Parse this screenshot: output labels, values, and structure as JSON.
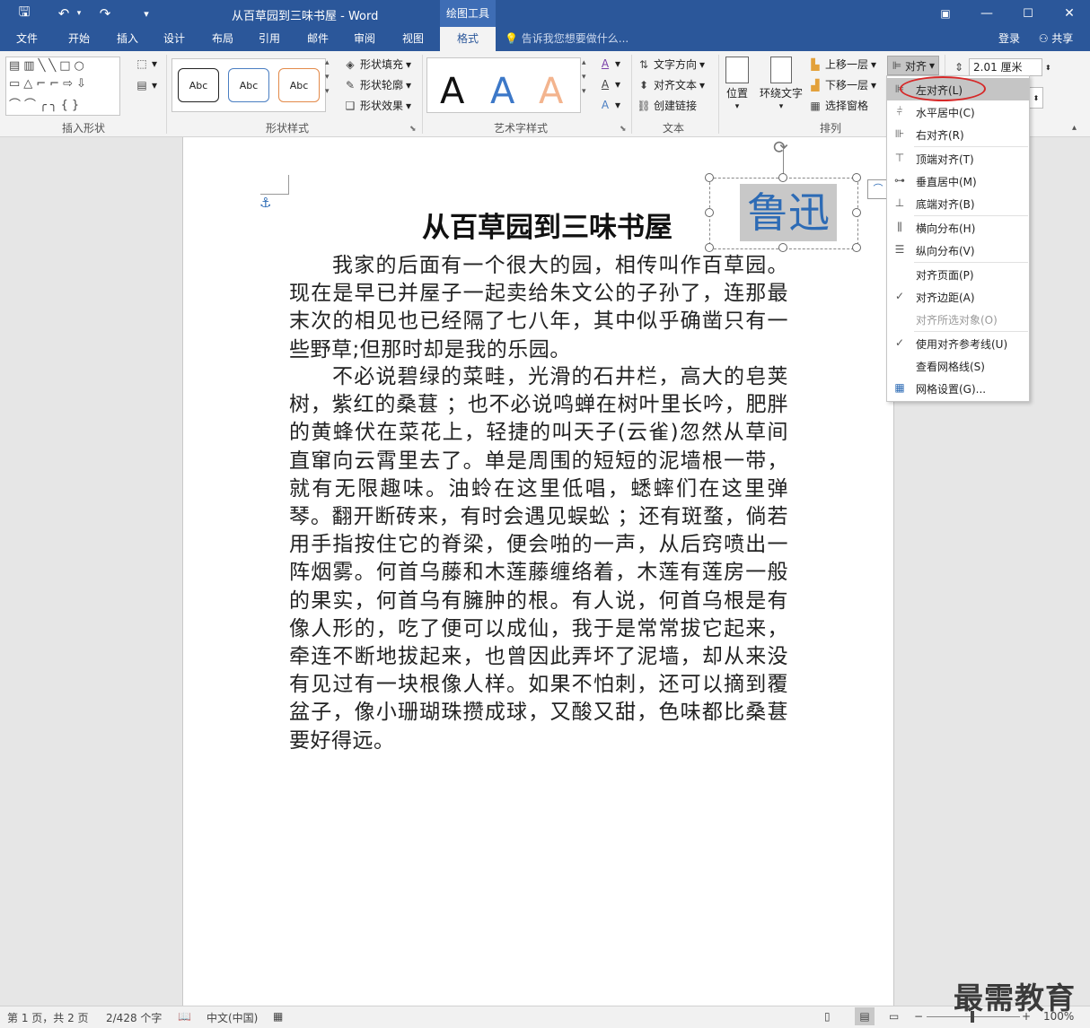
{
  "window": {
    "title": "从百草园到三味书屋 - Word",
    "context_label": "绘图工具"
  },
  "tabs": [
    "文件",
    "开始",
    "插入",
    "设计",
    "布局",
    "引用",
    "邮件",
    "审阅",
    "视图",
    "格式"
  ],
  "active_tab": "格式",
  "tell_me": "告诉我您想要做什么...",
  "login": "登录",
  "share": "共享",
  "ribbon": {
    "groups": {
      "insert_shapes": "插入形状",
      "shape_styles": "形状样式",
      "wordart_styles": "艺术字样式",
      "text": "文本",
      "arrange": "排列"
    },
    "shape_style_samples": [
      "Abc",
      "Abc",
      "Abc"
    ],
    "shape_fill": "形状填充",
    "shape_outline": "形状轮廓",
    "shape_effects": "形状效果",
    "wordart_letter": "A",
    "text_direction": "文字方向",
    "align_text": "对齐文本",
    "create_link": "创建链接",
    "position": "位置",
    "wrap_text": "环绕文字",
    "bring_forward": "上移一层",
    "send_backward": "下移一层",
    "selection_pane": "选择窗格",
    "align": "对齐",
    "height_value": "2.01 厘米"
  },
  "align_menu": [
    {
      "label": "左对齐(L)",
      "icon": "align-left-icon",
      "highlight": true
    },
    {
      "label": "水平居中(C)",
      "icon": "align-center-icon"
    },
    {
      "label": "右对齐(R)",
      "icon": "align-right-icon"
    },
    {
      "label": "顶端对齐(T)",
      "icon": "align-top-icon"
    },
    {
      "label": "垂直居中(M)",
      "icon": "align-middle-icon"
    },
    {
      "label": "底端对齐(B)",
      "icon": "align-bottom-icon"
    },
    {
      "label": "横向分布(H)",
      "icon": "distribute-horizontal-icon"
    },
    {
      "label": "纵向分布(V)",
      "icon": "distribute-vertical-icon"
    },
    {
      "label": "对齐页面(P)",
      "icon": ""
    },
    {
      "label": "对齐边距(A)",
      "icon": "check-icon"
    },
    {
      "label": "对齐所选对象(O)",
      "icon": "",
      "disabled": true
    },
    {
      "label": "使用对齐参考线(U)",
      "icon": "check-icon"
    },
    {
      "label": "查看网格线(S)",
      "icon": ""
    },
    {
      "label": "网格设置(G)...",
      "icon": "grid-icon"
    }
  ],
  "document": {
    "title": "从百草园到三味书屋",
    "textbox": "鲁迅",
    "paragraphs": [
      "我家的后面有一个很大的园，相传叫作百草园。现在是早已并屋子一起卖给朱文公的子孙了，连那最末次的相见也已经隔了七八年，其中似乎确凿只有一些野草;但那时却是我的乐园。",
      "不必说碧绿的菜畦，光滑的石井栏，高大的皂荚树，紫红的桑葚 ；也不必说鸣蝉在树叶里长吟，肥胖的黄蜂伏在菜花上，轻捷的叫天子(云雀)忽然从草间直窜向云霄里去了。单是周围的短短的泥墙根一带，就有无限趣味。油蛉在这里低唱，蟋蟀们在这里弹琴。翻开断砖来，有时会遇见蜈蚣 ；还有斑蝥，倘若用手指按住它的脊梁，便会啪的一声，从后窍喷出一阵烟雾。何首乌藤和木莲藤缠络着，木莲有莲房一般的果实，何首乌有臃肿的根。有人说，何首乌根是有像人形的，吃了便可以成仙，我于是常常拔它起来，牵连不断地拔起来，也曾因此弄坏了泥墙，却从来没有见过有一块根像人样。如果不怕刺，还可以摘到覆盆子，像小珊瑚珠攒成球，又酸又甜，色味都比桑葚要好得远。"
    ]
  },
  "status": {
    "page": "第 1 页，共 2 页",
    "words": "2/428 个字",
    "language": "中文(中国)",
    "zoom": "100%"
  },
  "watermark": "最需教育"
}
